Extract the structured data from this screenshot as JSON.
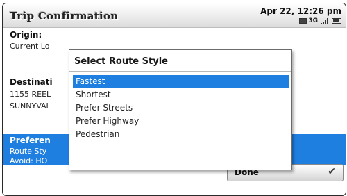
{
  "header": {
    "title": "Trip Confirmation",
    "datetime": "Apr 22, 12:26 pm",
    "network": "3G",
    "signal_bars": 4
  },
  "trip": {
    "origin_label": "Origin:",
    "origin_value": "Current Lo",
    "destination_label": "Destinati",
    "destination_line1": "1155 REEL",
    "destination_line2": "SUNNYVAL"
  },
  "preferences": {
    "label": "Preferen",
    "route_style": "Route Sty",
    "avoid": "Avoid: HO"
  },
  "done": {
    "label": "Done",
    "icon": "chevron-check-icon"
  },
  "dialog": {
    "title": "Select Route Style",
    "options": [
      "Fastest",
      "Shortest",
      "Prefer Streets",
      "Prefer Highway",
      "Pedestrian"
    ],
    "selected_index": 0
  },
  "colors": {
    "highlight": "#1f7fe0"
  }
}
